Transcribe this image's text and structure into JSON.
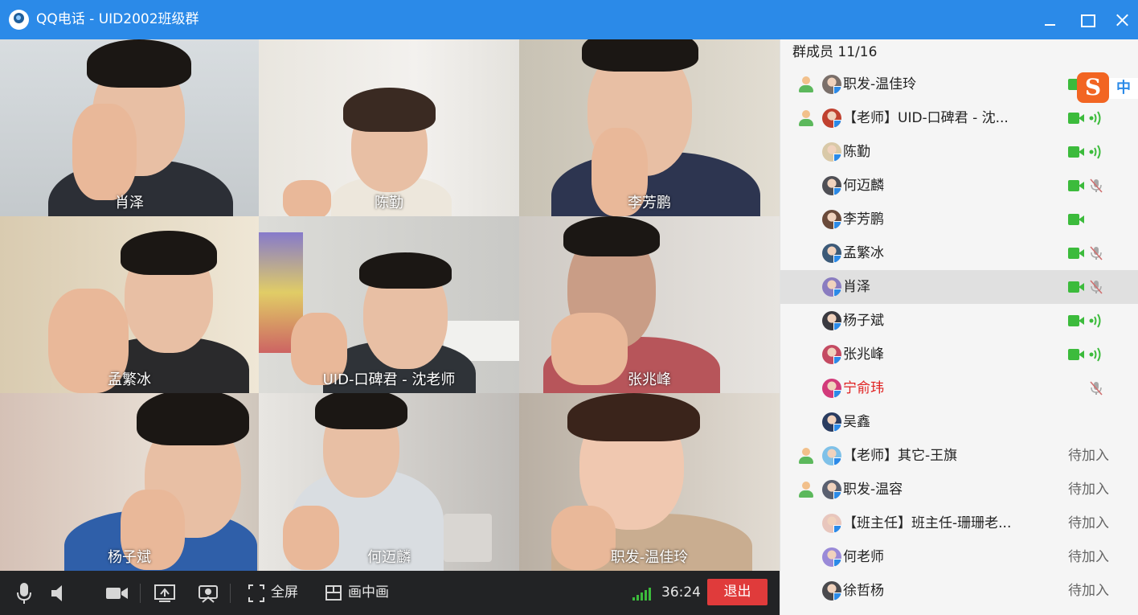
{
  "window": {
    "title": "QQ电话 - UID2002班级群"
  },
  "tiles": [
    {
      "name": "肖泽"
    },
    {
      "name": "陈勤"
    },
    {
      "name": "李芳鹏"
    },
    {
      "name": "孟繁冰"
    },
    {
      "name": "UID-口碑君 - 沈老师"
    },
    {
      "name": "张兆峰"
    },
    {
      "name": "杨子斌"
    },
    {
      "name": "何迈麟"
    },
    {
      "name": "职发-温佳玲"
    }
  ],
  "toolbar": {
    "fullscreen_label": "全屏",
    "pip_label": "画中画",
    "timer": "36:24",
    "exit_label": "退出"
  },
  "panel": {
    "header": "群成员 11/16",
    "members": [
      {
        "name": "职发-温佳玲",
        "host": true,
        "status": "",
        "camera": "on",
        "mic": "on"
      },
      {
        "name": "【老师】UID-口碑君 - 沈...",
        "host": true,
        "status": "",
        "camera": "on",
        "mic": "on"
      },
      {
        "name": "陈勤",
        "host": false,
        "status": "",
        "camera": "on",
        "mic": "on"
      },
      {
        "name": "何迈麟",
        "host": false,
        "status": "",
        "camera": "on",
        "mic": "muted"
      },
      {
        "name": "李芳鹏",
        "host": false,
        "status": "",
        "camera": "on",
        "mic": "none"
      },
      {
        "name": "孟繁冰",
        "host": false,
        "status": "",
        "camera": "on",
        "mic": "muted"
      },
      {
        "name": "肖泽",
        "host": false,
        "status": "",
        "camera": "on",
        "mic": "muted",
        "selected": true
      },
      {
        "name": "杨子斌",
        "host": false,
        "status": "",
        "camera": "on",
        "mic": "on"
      },
      {
        "name": "张兆峰",
        "host": false,
        "status": "",
        "camera": "on",
        "mic": "on"
      },
      {
        "name": "宁俞玮",
        "host": false,
        "status": "",
        "camera": "none",
        "mic": "muted",
        "red": true
      },
      {
        "name": "吴鑫",
        "host": false,
        "status": "",
        "camera": "none",
        "mic": "none"
      },
      {
        "name": "【老师】其它-王旗",
        "host": true,
        "status": "待加入"
      },
      {
        "name": "职发-温容",
        "host": true,
        "status": "待加入"
      },
      {
        "name": "【班主任】班主任-珊珊老...",
        "host": false,
        "status": "待加入"
      },
      {
        "name": "何老师",
        "host": false,
        "status": "待加入"
      },
      {
        "name": "徐哲杨",
        "host": false,
        "status": "待加入"
      }
    ]
  },
  "ime": {
    "logo": "S",
    "mode": "中"
  },
  "colors": {
    "titlebar": "#2b8ae8",
    "active_green": "#3cbb3c",
    "exit_red": "#e03b3b",
    "muted_gray": "#9a9a9a"
  }
}
